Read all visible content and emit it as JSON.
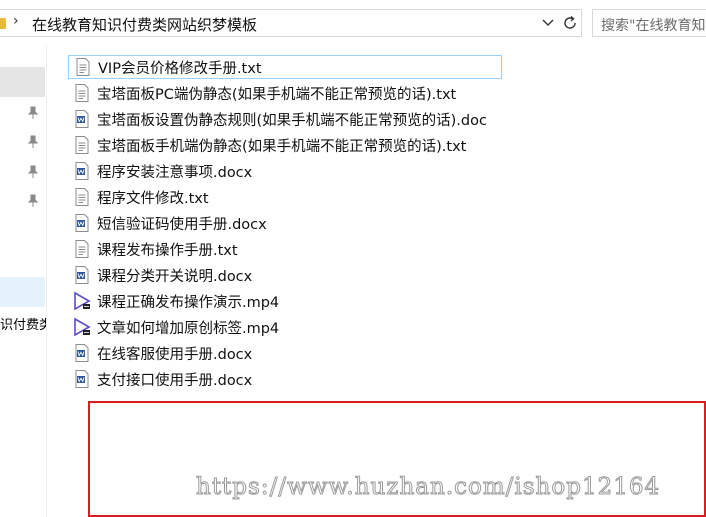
{
  "address_bar": {
    "path_segment": "在线教育知识付费类网站织梦模板",
    "separator": "›"
  },
  "search": {
    "placeholder": "搜索\"在线教育知"
  },
  "nav_pane": {
    "partial_item": "识付费类"
  },
  "files": [
    {
      "name": "VIP会员价格修改手册.txt",
      "type": "txt",
      "selected": true
    },
    {
      "name": "宝塔面板PC端伪静态(如果手机端不能正常预览的话).txt",
      "type": "txt"
    },
    {
      "name": "宝塔面板设置伪静态规则(如果手机端不能正常预览的话).doc",
      "type": "doc"
    },
    {
      "name": "宝塔面板手机端伪静态(如果手机端不能正常预览的话).txt",
      "type": "txt"
    },
    {
      "name": "程序安装注意事项.docx",
      "type": "doc"
    },
    {
      "name": "程序文件修改.txt",
      "type": "txt"
    },
    {
      "name": "短信验证码使用手册.docx",
      "type": "doc"
    },
    {
      "name": "课程发布操作手册.txt",
      "type": "txt"
    },
    {
      "name": "课程分类开关说明.docx",
      "type": "doc"
    },
    {
      "name": "课程正确发布操作演示.mp4",
      "type": "mp4"
    },
    {
      "name": "文章如何增加原创标签.mp4",
      "type": "mp4"
    },
    {
      "name": "在线客服使用手册.docx",
      "type": "doc"
    },
    {
      "name": "支付接口使用手册.docx",
      "type": "doc"
    }
  ],
  "watermark": {
    "text": "https://www.huzhan.com/ishop12164"
  },
  "colors": {
    "selection_border": "#99d1ff",
    "watermark_box": "#d81e1e",
    "word_icon": "#2b579a",
    "video_icon": "#5b4ec9"
  }
}
